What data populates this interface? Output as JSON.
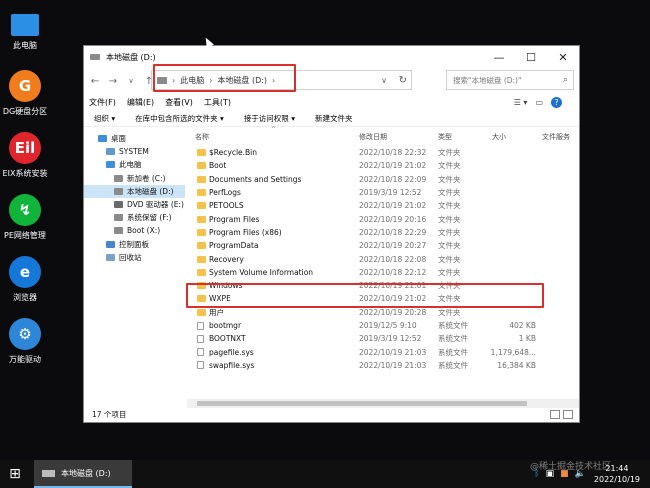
{
  "desktop": {
    "icons": [
      {
        "label": "此电脑",
        "icon": "computer-icon",
        "color": "#2b8fe6",
        "glyph": ""
      },
      {
        "label": "DG硬盘分区",
        "icon": "diskgenius-icon",
        "color": "#f07c1d",
        "glyph": "G"
      },
      {
        "label": "EIX系统安装",
        "icon": "eix-icon",
        "color": "#e0262c",
        "glyph": "Eil"
      },
      {
        "label": "PE网络管理",
        "icon": "network-icon",
        "color": "#11b43a",
        "glyph": "↯"
      },
      {
        "label": "浏览器",
        "icon": "ie-browser-icon",
        "color": "#1577d8",
        "glyph": "e"
      },
      {
        "label": "万能驱动",
        "icon": "gear-icon",
        "color": "#2e86d9",
        "glyph": "⚙"
      }
    ]
  },
  "window": {
    "title": "本地磁盘 (D:)",
    "controls": {
      "minimize": "—",
      "maximize": "☐",
      "close": "✕"
    },
    "address": {
      "crumbs": [
        "此电脑",
        "本地磁盘 (D:)"
      ],
      "sep": "›"
    },
    "search_placeholder": "搜索\"本地磁盘 (D:)\"",
    "menu": [
      "文件(F)",
      "编辑(E)",
      "查看(V)",
      "工具(T)"
    ],
    "commands": [
      "组织 ▾",
      "在库中包含所选的文件夹 ▾",
      "接于访问权限 ▾",
      "新建文件夹"
    ],
    "nav": [
      {
        "label": "桌面",
        "color": "#3d8fd8",
        "indent": 4
      },
      {
        "label": "SYSTEM",
        "color": "#5f9bd1",
        "indent": 12
      },
      {
        "label": "此电脑",
        "color": "#3d8fd8",
        "indent": 12
      },
      {
        "label": "新加卷 (C:)",
        "color": "#8a8a8a",
        "indent": 20
      },
      {
        "label": "本地磁盘 (D:)",
        "color": "#8a8a8a",
        "indent": 20,
        "selected": true
      },
      {
        "label": "DVD 驱动器 (E:) C",
        "color": "#6a6a6a",
        "indent": 20
      },
      {
        "label": "系统保留 (F:)",
        "color": "#8a8a8a",
        "indent": 20
      },
      {
        "label": "Boot (X:)",
        "color": "#8a8a8a",
        "indent": 20
      },
      {
        "label": "控制面板",
        "color": "#4b86c9",
        "indent": 12
      },
      {
        "label": "回收站",
        "color": "#7ba2c8",
        "indent": 12
      }
    ],
    "columns": {
      "name": "名称",
      "date": "修改日期",
      "type": "类型",
      "size": "大小",
      "extra": "文件服务"
    },
    "files": [
      {
        "name": "$Recycle.Bin",
        "date": "2022/10/18 22:32",
        "type": "文件夹",
        "size": "",
        "kind": "folder"
      },
      {
        "name": "Boot",
        "date": "2022/10/19 21:02",
        "type": "文件夹",
        "size": "",
        "kind": "folder"
      },
      {
        "name": "Documents and Settings",
        "date": "2022/10/18 22:09",
        "type": "文件夹",
        "size": "",
        "kind": "folder"
      },
      {
        "name": "PerfLogs",
        "date": "2019/3/19 12:52",
        "type": "文件夹",
        "size": "",
        "kind": "folder"
      },
      {
        "name": "PETOOLS",
        "date": "2022/10/19 21:02",
        "type": "文件夹",
        "size": "",
        "kind": "folder"
      },
      {
        "name": "Program Files",
        "date": "2022/10/19 20:16",
        "type": "文件夹",
        "size": "",
        "kind": "folder"
      },
      {
        "name": "Program Files (x86)",
        "date": "2022/10/18 22:29",
        "type": "文件夹",
        "size": "",
        "kind": "folder"
      },
      {
        "name": "ProgramData",
        "date": "2022/10/19 20:27",
        "type": "文件夹",
        "size": "",
        "kind": "folder"
      },
      {
        "name": "Recovery",
        "date": "2022/10/18 22:08",
        "type": "文件夹",
        "size": "",
        "kind": "folder"
      },
      {
        "name": "System Volume Information",
        "date": "2022/10/18 22:12",
        "type": "文件夹",
        "size": "",
        "kind": "folder"
      },
      {
        "name": "Windows",
        "date": "2022/10/19 21:01",
        "type": "文件夹",
        "size": "",
        "kind": "folder"
      },
      {
        "name": "WXPE",
        "date": "2022/10/19 21:02",
        "type": "文件夹",
        "size": "",
        "kind": "folder"
      },
      {
        "name": "用户",
        "date": "2022/10/19 20:28",
        "type": "文件夹",
        "size": "",
        "kind": "folder"
      },
      {
        "name": "bootmgr",
        "date": "2019/12/5 9:10",
        "type": "系统文件",
        "size": "402 KB",
        "kind": "file"
      },
      {
        "name": "BOOTNXT",
        "date": "2019/3/19 12:52",
        "type": "系统文件",
        "size": "1 KB",
        "kind": "file"
      },
      {
        "name": "pagefile.sys",
        "date": "2022/10/19 21:03",
        "type": "系统文件",
        "size": "1,179,648...",
        "kind": "file"
      },
      {
        "name": "swapfile.sys",
        "date": "2022/10/19 21:03",
        "type": "系统文件",
        "size": "16,384 KB",
        "kind": "file"
      }
    ],
    "status": "17 个项目"
  },
  "taskbar": {
    "start_icon": "windows-start-icon",
    "task_label": "本地磁盘 (D:)",
    "time": "21:44",
    "date": "2022/10/19"
  },
  "watermark": "@稀土掘金技术社区",
  "colors": {
    "highlight_red": "#d9302c",
    "selection": "#cce4f7",
    "folder": "#f3c34e"
  }
}
